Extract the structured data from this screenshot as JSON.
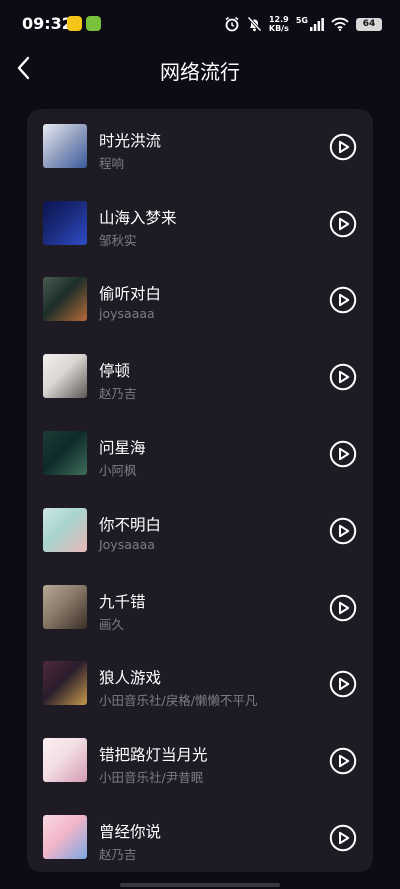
{
  "status_bar": {
    "time": "09:32",
    "net_speed_value": "12.9",
    "net_speed_unit": "KB/s",
    "network_type": "5G",
    "battery": "64"
  },
  "header": {
    "title": "网络流行",
    "back_icon": "chevron-left-icon"
  },
  "songs": [
    {
      "title": "时光洪流",
      "artist": "程响",
      "cover_colors": [
        "#9aa6c4",
        "#3a5a9c",
        "#e7ecf4"
      ]
    },
    {
      "title": "山海入梦来",
      "artist": "邹秋实",
      "cover_colors": [
        "#1a2a7a",
        "#2e4cc8",
        "#0c1450"
      ]
    },
    {
      "title": "偷听对白",
      "artist": "joysaaaa",
      "cover_colors": [
        "#1c2e2a",
        "#b86b3a",
        "#4a5a52"
      ]
    },
    {
      "title": "停顿",
      "artist": "赵乃吉",
      "cover_colors": [
        "#d9d6d2",
        "#5a5754",
        "#f2f0ee"
      ]
    },
    {
      "title": "问星海",
      "artist": "小阿枫",
      "cover_colors": [
        "#0e2a28",
        "#3e6e5c",
        "#1b3d38"
      ]
    },
    {
      "title": "你不明白",
      "artist": "Joysaaaa",
      "cover_colors": [
        "#a9d4cf",
        "#e8b7b5",
        "#cce6e2"
      ]
    },
    {
      "title": "九千错",
      "artist": "画久",
      "cover_colors": [
        "#8a7a6a",
        "#3a2e26",
        "#b7a795"
      ]
    },
    {
      "title": "狼人游戏",
      "artist": "小田音乐社/戾格/懒懒不平凡",
      "cover_colors": [
        "#2a1d2c",
        "#c89a4a",
        "#4e2a3c"
      ]
    },
    {
      "title": "错把路灯当月光",
      "artist": "小田音乐社/尹昔眠",
      "cover_colors": [
        "#f2dde4",
        "#d49ab0",
        "#fbeff3"
      ]
    },
    {
      "title": "曾经你说",
      "artist": "赵乃吉",
      "cover_colors": [
        "#f3b6c8",
        "#7aa6e0",
        "#f8d8e2"
      ]
    }
  ],
  "icons": {
    "play": "play-circle-icon"
  }
}
